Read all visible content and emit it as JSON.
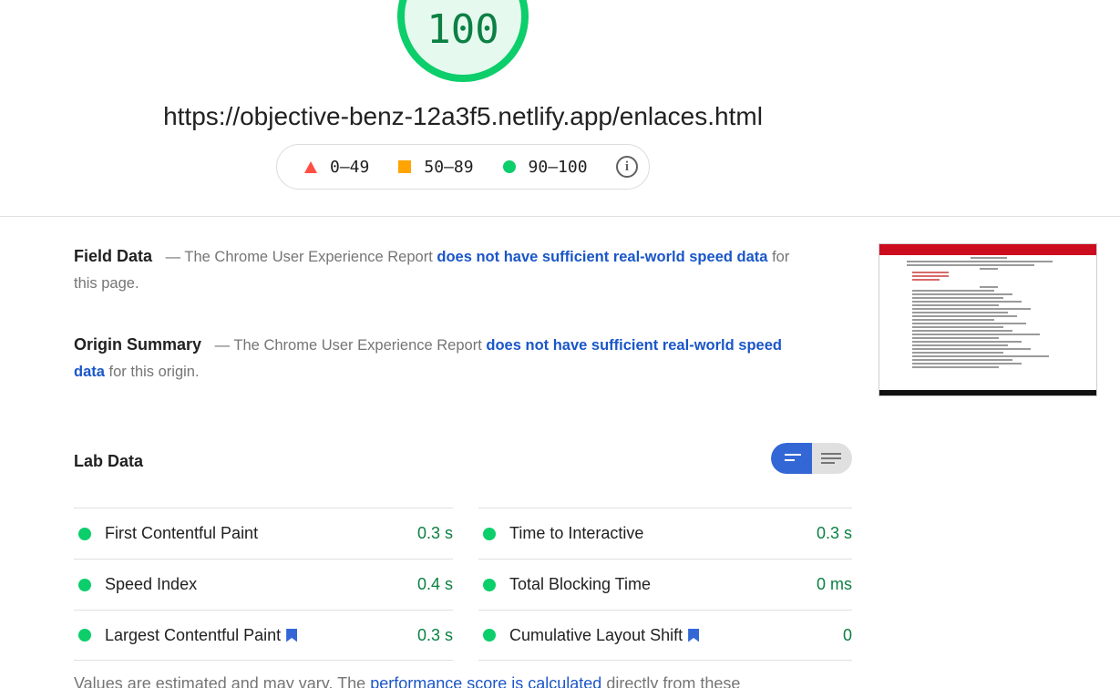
{
  "score": {
    "value": "100",
    "color": "#0cce6b"
  },
  "url": "https://objective-benz-12a3f5.netlify.app/enlaces.html",
  "legend": {
    "fail": "0–49",
    "average": "50–89",
    "pass": "90–100",
    "info_icon": "info-icon"
  },
  "field_data": {
    "title": "Field Data",
    "prefix": "— The Chrome User Experience Report",
    "link": "does not have sufficient real-world speed data",
    "suffix": "for this page."
  },
  "origin_summary": {
    "title": "Origin Summary",
    "prefix": "— The Chrome User Experience Report",
    "link": "does not have sufficient real-world speed data",
    "suffix": "for this origin."
  },
  "lab_data": {
    "title": "Lab Data",
    "metrics_left": [
      {
        "name": "First Contentful Paint",
        "value": "0.3 s"
      },
      {
        "name": "Speed Index",
        "value": "0.4 s"
      },
      {
        "name": "Largest Contentful Paint",
        "value": "0.3 s"
      }
    ],
    "metrics_right": [
      {
        "name": "Time to Interactive",
        "value": "0.3 s"
      },
      {
        "name": "Total Blocking Time",
        "value": "0 ms"
      },
      {
        "name": "Cumulative Layout Shift",
        "value": "0"
      }
    ]
  },
  "footnote": {
    "prefix": "Values are estimated and may vary. The",
    "link": "performance score is calculated",
    "suffix": "directly from these"
  },
  "colors": {
    "pass": "#0cce6b",
    "average": "#ffa400",
    "fail": "#ff4e42",
    "link": "#1a56c8",
    "pass_text": "#0b8043"
  }
}
